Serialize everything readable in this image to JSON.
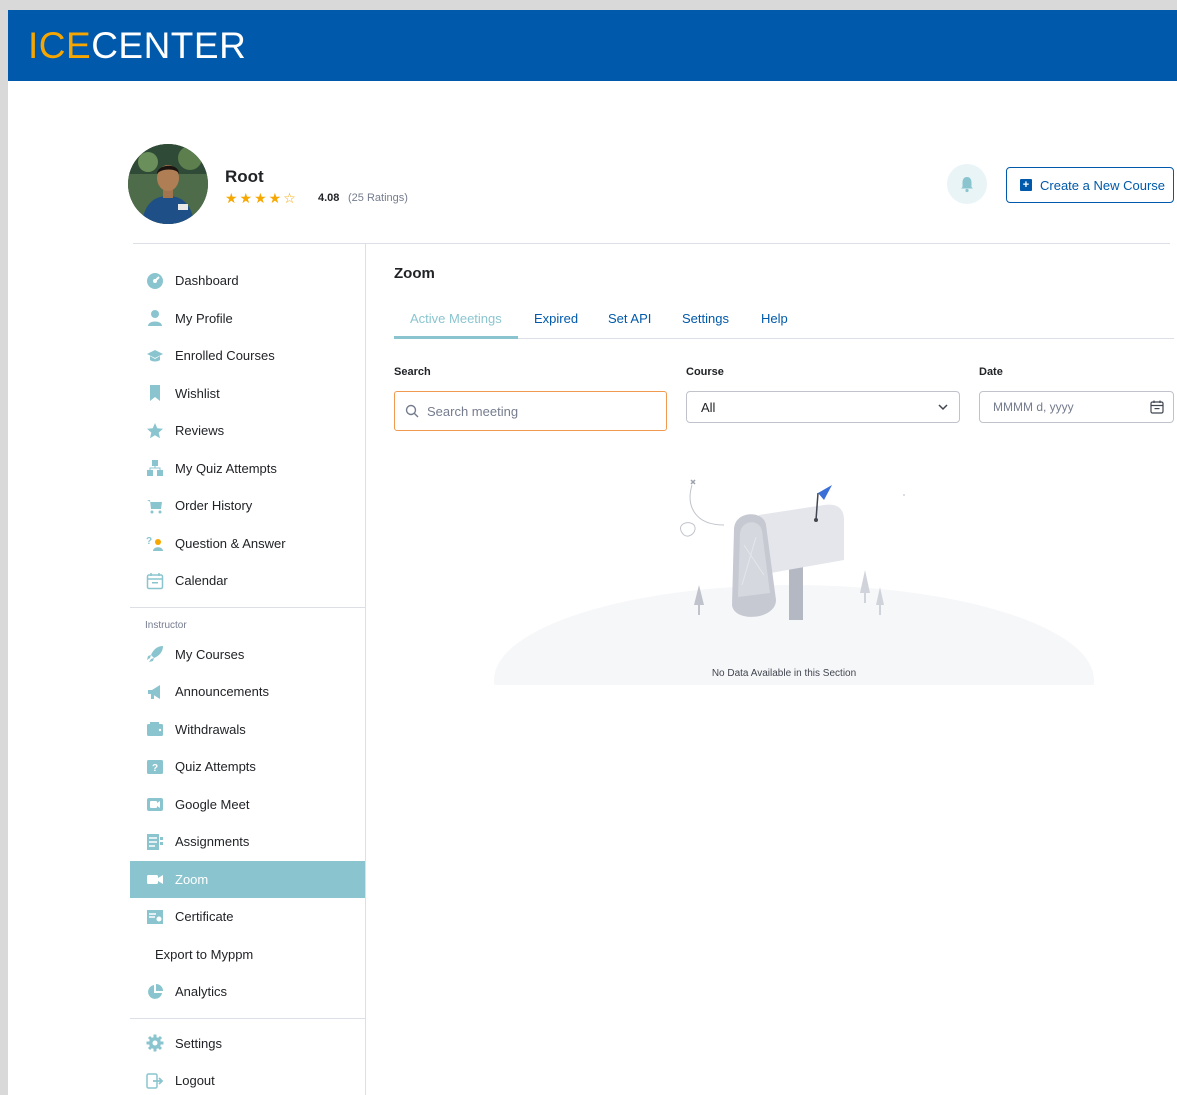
{
  "brand": {
    "logo_part1": "ICE",
    "logo_part2": "CENTER"
  },
  "colors": {
    "topbar": "#0059ab",
    "accent": "#8ac5cf",
    "star": "#f6a700",
    "search_focus": "#f09a4f"
  },
  "profile": {
    "name": "Root",
    "stars": "★★★★☆",
    "rating": "4.08",
    "rating_count": "(25 Ratings)",
    "rating_value": 4.08
  },
  "header": {
    "create_course_label": "Create a New Course"
  },
  "sidebar": {
    "items": [
      {
        "label": "Dashboard",
        "icon": "dashboard-icon"
      },
      {
        "label": "My Profile",
        "icon": "user-icon"
      },
      {
        "label": "Enrolled Courses",
        "icon": "graduation-cap-icon"
      },
      {
        "label": "Wishlist",
        "icon": "bookmark-icon"
      },
      {
        "label": "Reviews",
        "icon": "star-icon"
      },
      {
        "label": "My Quiz Attempts",
        "icon": "quiz-attempts-icon"
      },
      {
        "label": "Order History",
        "icon": "cart-icon"
      },
      {
        "label": "Question & Answer",
        "icon": "question-answer-icon"
      },
      {
        "label": "Calendar",
        "icon": "calendar-icon"
      }
    ],
    "instructor_label": "Instructor",
    "instructor_items": [
      {
        "label": "My Courses",
        "icon": "rocket-icon"
      },
      {
        "label": "Announcements",
        "icon": "megaphone-icon"
      },
      {
        "label": "Withdrawals",
        "icon": "wallet-icon"
      },
      {
        "label": "Quiz Attempts",
        "icon": "quiz-icon"
      },
      {
        "label": "Google Meet",
        "icon": "google-meet-icon"
      },
      {
        "label": "Assignments",
        "icon": "assignments-icon"
      },
      {
        "label": "Zoom",
        "icon": "zoom-camera-icon",
        "active": true
      },
      {
        "label": "Certificate",
        "icon": "certificate-icon"
      },
      {
        "label": "Export to Myppm",
        "icon": ""
      },
      {
        "label": "Analytics",
        "icon": "pie-chart-icon"
      }
    ],
    "bottom_items": [
      {
        "label": "Settings",
        "icon": "gear-icon"
      },
      {
        "label": "Logout",
        "icon": "logout-icon"
      }
    ]
  },
  "main": {
    "title": "Zoom",
    "tabs": [
      "Active Meetings",
      "Expired",
      "Set API",
      "Settings",
      "Help"
    ],
    "active_tab": "Active Meetings",
    "filters": {
      "search_label": "Search",
      "search_placeholder": "Search meeting",
      "course_label": "Course",
      "course_value": "All",
      "date_label": "Date",
      "date_placeholder": "MMMM d, yyyy"
    },
    "empty_message": "No Data Available in this Section"
  }
}
